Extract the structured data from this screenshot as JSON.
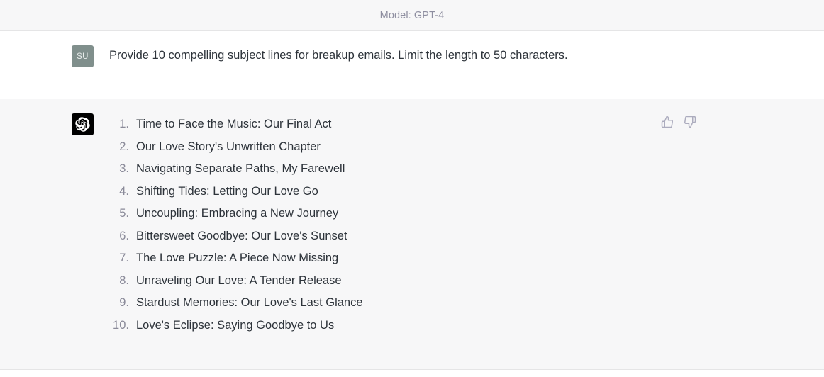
{
  "header": {
    "model_label": "Model: GPT-4"
  },
  "colors": {
    "header_bg": "#f7f7f8",
    "user_bg": "#ffffff",
    "assistant_bg": "#f7f7f8",
    "divider": "#e5e5e6",
    "text": "#2d333a",
    "muted_text": "#8e8ea0",
    "user_avatar_bg": "#808f8c",
    "assistant_avatar_bg": "#000000",
    "icon": "#acacbe"
  },
  "conversation": {
    "user": {
      "avatar_initials": "SU",
      "avatar_icon": "user-avatar",
      "message": "Provide 10 compelling subject lines for breakup emails. Limit the length to 50 characters."
    },
    "assistant": {
      "avatar_icon": "openai-logo-icon",
      "list_items": [
        "Time to Face the Music: Our Final Act",
        "Our Love Story's Unwritten Chapter",
        "Navigating Separate Paths, My Farewell",
        "Shifting Tides: Letting Our Love Go",
        "Uncoupling: Embracing a New Journey",
        "Bittersweet Goodbye: Our Love's Sunset",
        "The Love Puzzle: A Piece Now Missing",
        "Unraveling Our Love: A Tender Release",
        "Stardust Memories: Our Love's Last Glance",
        "Love's Eclipse: Saying Goodbye to Us"
      ],
      "feedback": {
        "thumbs_up_icon": "thumbs-up-icon",
        "thumbs_down_icon": "thumbs-down-icon"
      }
    }
  }
}
